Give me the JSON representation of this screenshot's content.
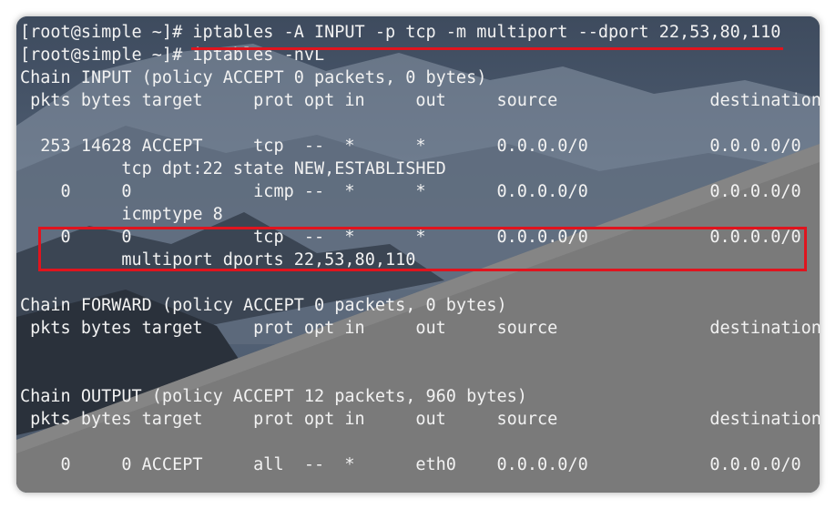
{
  "terminal": {
    "lines": [
      "[root@simple ~]# iptables -A INPUT -p tcp -m multiport --dport 22,53,80,110",
      "[root@simple ~]# iptables -nvL",
      "Chain INPUT (policy ACCEPT 0 packets, 0 bytes)",
      " pkts bytes target     prot opt in     out     source               destination",
      "",
      "  253 14628 ACCEPT     tcp  --  *      *       0.0.0.0/0            0.0.0.0/0",
      "          tcp dpt:22 state NEW,ESTABLISHED",
      "    0     0            icmp --  *      *       0.0.0.0/0            0.0.0.0/0",
      "          icmptype 8",
      "    0     0            tcp  --  *      *       0.0.0.0/0            0.0.0.0/0",
      "          multiport dports 22,53,80,110",
      "",
      "Chain FORWARD (policy ACCEPT 0 packets, 0 bytes)",
      " pkts bytes target     prot opt in     out     source               destination",
      "",
      "",
      "Chain OUTPUT (policy ACCEPT 12 packets, 960 bytes)",
      " pkts bytes target     prot opt in     out     source               destination",
      "",
      "    0     0 ACCEPT     all  --  *      eth0    0.0.0.0/0            0.0.0.0/0"
    ]
  },
  "colors": {
    "text": "#f2f2f2",
    "highlight": "#e0141e",
    "sky": "#4f5f72",
    "slope": "#7a7a7a"
  }
}
